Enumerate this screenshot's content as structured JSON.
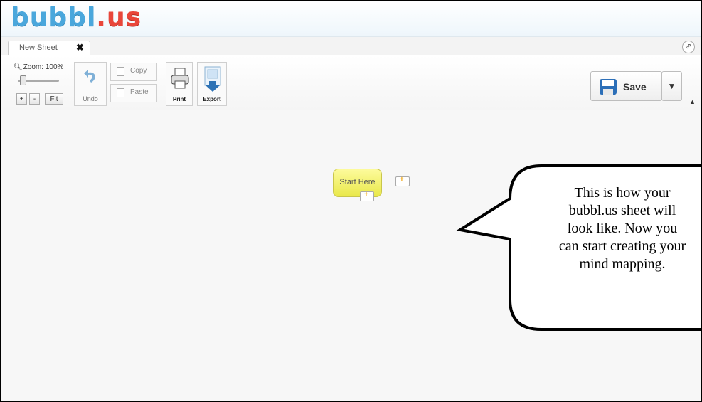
{
  "app": {
    "logo_part1": "bubbl",
    "logo_dot": ".",
    "logo_part2": "us"
  },
  "tabs": [
    {
      "label": "New Sheet",
      "close_icon": "close-icon"
    }
  ],
  "tabstrip": {
    "collapse_icon": "⇗"
  },
  "toolbar": {
    "zoom_label": "Zoom: 100%",
    "zoom_in_label": "+",
    "zoom_out_label": "-",
    "fit_label": "Fit",
    "undo_label": "Undo",
    "copy_label": "Copy",
    "paste_label": "Paste",
    "print_label": "Print",
    "export_label": "Export",
    "save_label": "Save",
    "save_dropdown_icon": "▼",
    "scroll_up_icon": "▲"
  },
  "canvas": {
    "root_node_label": "Start Here",
    "handle_plus": "+"
  },
  "callout": {
    "lines": [
      "This is how your",
      "bubbl.us sheet will",
      "look like. Now you",
      "can start creating your",
      "mind mapping."
    ]
  },
  "colors": {
    "logo_blue": "#4aa7dc",
    "logo_red": "#e9463a",
    "node_fill": "#f5f36e",
    "save_icon_blue": "#2c6fb8"
  }
}
